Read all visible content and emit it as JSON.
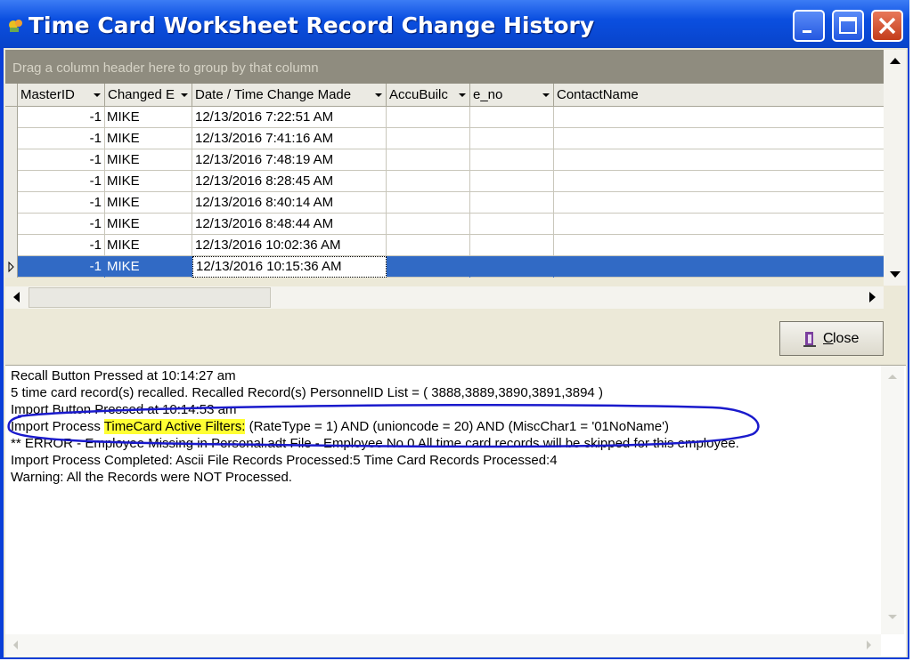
{
  "window": {
    "title": "Time Card Worksheet Record Change History",
    "icon": "app-icon",
    "controls": [
      "minimize-icon",
      "maximize-icon",
      "close-icon"
    ]
  },
  "grid": {
    "group_hint": "Drag a column header here to group by that column",
    "columns": [
      "MasterID",
      "Changed E",
      "Date / Time Change Made",
      "AccuBuilc",
      "e_no",
      "ContactName"
    ],
    "rows": [
      {
        "master_id": "-1",
        "changed_by": "MIKE",
        "datetime": "12/13/2016 7:22:51 AM"
      },
      {
        "master_id": "-1",
        "changed_by": "MIKE",
        "datetime": "12/13/2016 7:41:16 AM"
      },
      {
        "master_id": "-1",
        "changed_by": "MIKE",
        "datetime": "12/13/2016 7:48:19 AM"
      },
      {
        "master_id": "-1",
        "changed_by": "MIKE",
        "datetime": "12/13/2016 8:28:45 AM"
      },
      {
        "master_id": "-1",
        "changed_by": "MIKE",
        "datetime": "12/13/2016 8:40:14 AM"
      },
      {
        "master_id": "-1",
        "changed_by": "MIKE",
        "datetime": "12/13/2016 8:48:44 AM"
      },
      {
        "master_id": "-1",
        "changed_by": "MIKE",
        "datetime": "12/13/2016 10:02:36 AM"
      },
      {
        "master_id": "-1",
        "changed_by": "MIKE",
        "datetime": "12/13/2016 10:15:36 AM"
      }
    ],
    "selected_row_index": 7
  },
  "close_button": {
    "label_accel": "C",
    "label_rest": "lose",
    "icon": "door-exit-icon"
  },
  "log": {
    "lines": [
      "Recall Button Pressed at 10:14:27 am",
      "5 time card record(s) recalled. Recalled Record(s) PersonnelID List = ( 3888,3889,3890,3891,3894 )",
      "Import Button Pressed at 10:14:53 am",
      "** ERROR - Employee Missing in Personal.adt File - Employee No 0 All time card records will be skipped for this employee.",
      "Import Process Completed: Ascii File Records Processed:5 Time Card Records Processed:4",
      "Warning: All the Records were NOT Processed."
    ],
    "filter_line": {
      "prefix": "Import Process ",
      "highlight": "TimeCard Active Filters:",
      "suffix": " (RateType = 1) AND (unioncode = 20) AND (MiscChar1 = '01NoName')"
    }
  },
  "colors": {
    "title_bar": "#0b4fe0",
    "selection": "#316ac5",
    "highlight": "#ffff33",
    "annotation_ellipse": "#1a1acc"
  }
}
